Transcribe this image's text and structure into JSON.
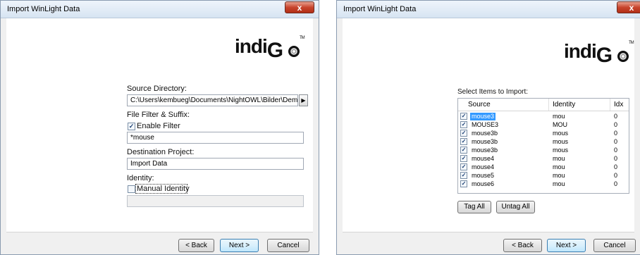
{
  "dialog1": {
    "title": "Import WinLight Data",
    "close_label": "x",
    "logo": {
      "text": "indi",
      "g": "G",
      "tm": "TM"
    },
    "source_dir_label": "Source Directory:",
    "source_dir_value": "C:\\Users\\kembueg\\Documents\\NightOWL\\Bilder\\Demo Rom 10",
    "browse_arrow": "▶",
    "filter_label": "File Filter & Suffix:",
    "enable_filter_label": "Enable Filter",
    "enable_filter_checked": "✓",
    "filter_value": "*mouse",
    "dest_label": "Destination Project:",
    "dest_value": "Import Data",
    "identity_label": "Identity:",
    "manual_identity_label": "Manual Identity",
    "manual_identity_checked": "",
    "identity_value": "",
    "back": "< Back",
    "next": "Next >",
    "cancel": "Cancel"
  },
  "dialog2": {
    "title": "Import WinLight Data",
    "close_label": "x",
    "logo": {
      "text": "indi",
      "g": "G",
      "tm": "TM"
    },
    "select_label": "Select Items to Import:",
    "columns": {
      "source": "Source",
      "identity": "Identity",
      "idx": "Idx"
    },
    "rows": [
      {
        "check": "✓",
        "source": "mouse3",
        "identity": "mou",
        "idx": "0"
      },
      {
        "check": "✓",
        "source": "MOUSE3",
        "identity": "MOU",
        "idx": "0"
      },
      {
        "check": "✓",
        "source": "mouse3b",
        "identity": "mous",
        "idx": "0"
      },
      {
        "check": "✓",
        "source": "mouse3b",
        "identity": "mous",
        "idx": "0"
      },
      {
        "check": "✓",
        "source": "mouse3b",
        "identity": "mous",
        "idx": "0"
      },
      {
        "check": "✓",
        "source": "mouse4",
        "identity": "mou",
        "idx": "0"
      },
      {
        "check": "✓",
        "source": "mouse4",
        "identity": "mou",
        "idx": "0"
      },
      {
        "check": "✓",
        "source": "mouse5",
        "identity": "mou",
        "idx": "0"
      },
      {
        "check": "✓",
        "source": "mouse6",
        "identity": "mou",
        "idx": "0"
      }
    ],
    "tag_all": "Tag All",
    "untag_all": "Untag All",
    "back": "< Back",
    "next": "Next >",
    "cancel": "Cancel"
  },
  "colors": {
    "accent": "#3399ff",
    "close": "#c8452d"
  }
}
